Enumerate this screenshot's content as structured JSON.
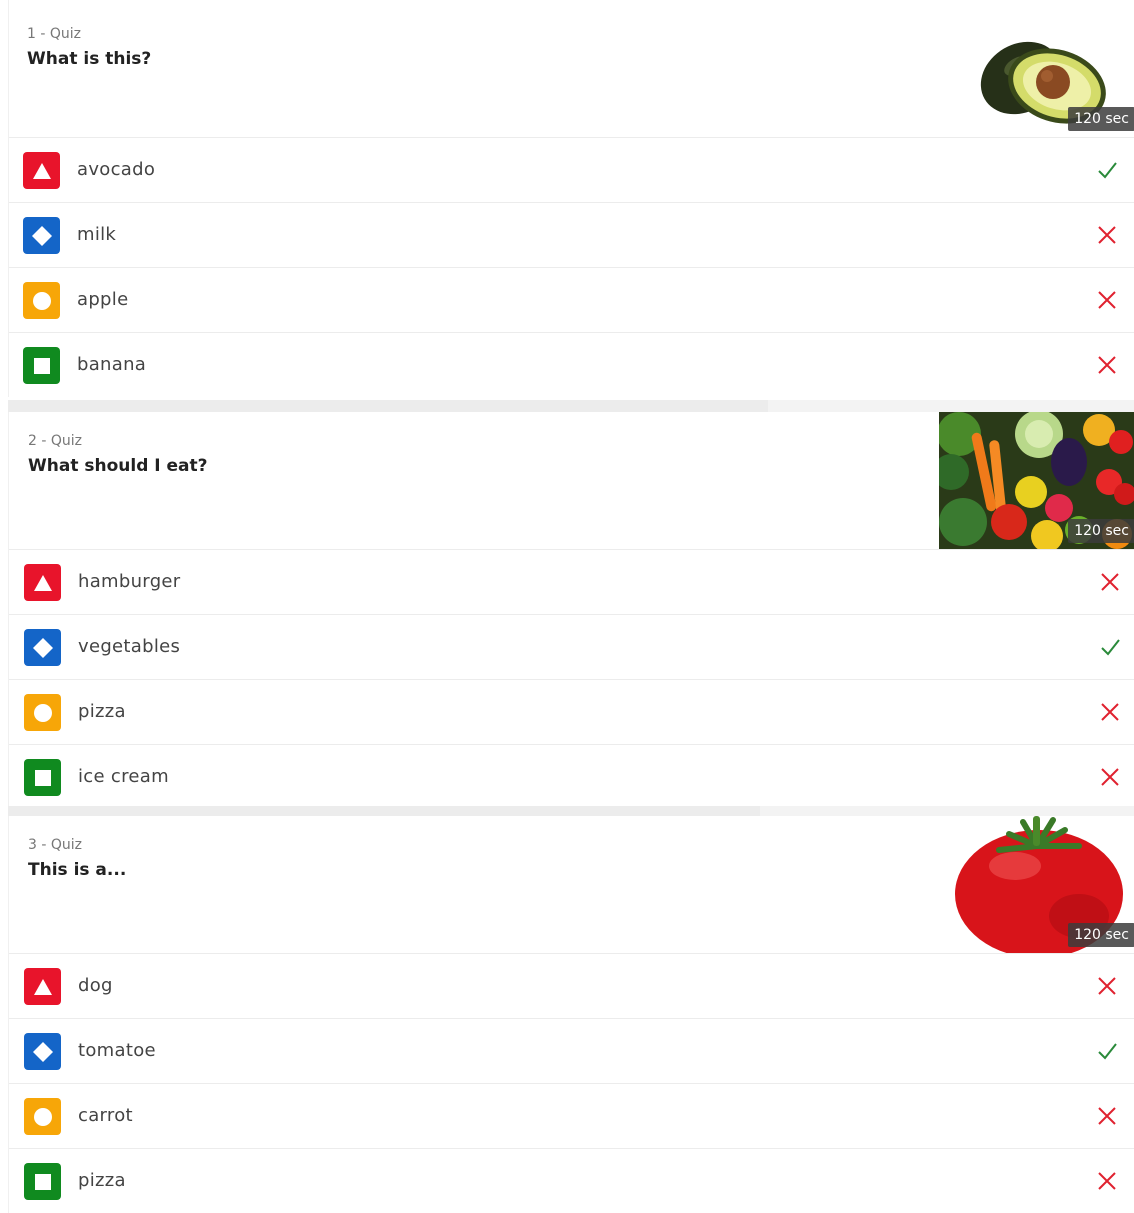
{
  "colors": {
    "red": "#e8142b",
    "blue": "#1465c8",
    "yellow": "#f7a608",
    "green": "#108a1f",
    "correct": "#2a8a3a",
    "wrong": "#e0222f"
  },
  "questions": [
    {
      "number": "1 - Quiz",
      "text": "What is this?",
      "image": "avocado-image",
      "timer": "120 sec",
      "answers": [
        {
          "shape": "triangle",
          "label": "avocado",
          "correct": true
        },
        {
          "shape": "diamond",
          "label": "milk",
          "correct": false
        },
        {
          "shape": "circle",
          "label": "apple",
          "correct": false
        },
        {
          "shape": "square",
          "label": "banana",
          "correct": false
        }
      ]
    },
    {
      "number": "2 - Quiz",
      "text": "What should I eat?",
      "image": "vegetables-image",
      "timer": "120 sec",
      "answers": [
        {
          "shape": "triangle",
          "label": "hamburger",
          "correct": false
        },
        {
          "shape": "diamond",
          "label": "vegetables",
          "correct": true
        },
        {
          "shape": "circle",
          "label": "pizza",
          "correct": false
        },
        {
          "shape": "square",
          "label": "ice cream",
          "correct": false
        }
      ]
    },
    {
      "number": "3 - Quiz",
      "text": "This is a...",
      "image": "tomato-image",
      "timer": "120 sec",
      "answers": [
        {
          "shape": "triangle",
          "label": "dog",
          "correct": false
        },
        {
          "shape": "diamond",
          "label": "tomatoe",
          "correct": true
        },
        {
          "shape": "circle",
          "label": "carrot",
          "correct": false
        },
        {
          "shape": "square",
          "label": "pizza",
          "correct": false
        }
      ]
    }
  ]
}
